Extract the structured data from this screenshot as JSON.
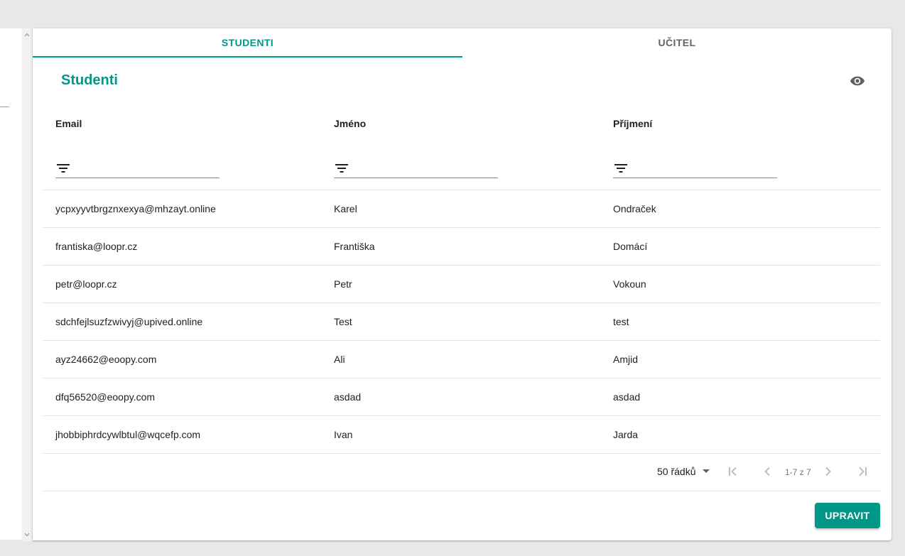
{
  "tabs": [
    {
      "label": "STUDENTI",
      "active": true
    },
    {
      "label": "UČITEL",
      "active": false
    }
  ],
  "section": {
    "title": "Studenti",
    "action_icon": "eye-icon"
  },
  "table": {
    "columns": [
      "Email",
      "Jméno",
      "Příjmení"
    ],
    "filter_icon": "filter-icon",
    "rows": [
      {
        "email": "ycpxyyvtbrgznxexya@mhzayt.online",
        "first_name": "Karel",
        "last_name": "Ondraček"
      },
      {
        "email": "frantiska@loopr.cz",
        "first_name": "Františka",
        "last_name": "Domácí"
      },
      {
        "email": "petr@loopr.cz",
        "first_name": "Petr",
        "last_name": "Vokoun"
      },
      {
        "email": "sdchfejlsuzfzwivyj@upived.online",
        "first_name": "Test",
        "last_name": "test"
      },
      {
        "email": "ayz24662@eoopy.com",
        "first_name": "Ali",
        "last_name": "Amjid"
      },
      {
        "email": "dfq56520@eoopy.com",
        "first_name": "asdad",
        "last_name": "asdad"
      },
      {
        "email": "jhobbiphrdcywlbtul@wqcefp.com",
        "first_name": "Ivan",
        "last_name": "Jarda"
      }
    ]
  },
  "pagination": {
    "rows_per_page": "50 řádků",
    "range": "1-7 z 7"
  },
  "actions": {
    "edit_label": "UPRAVIT"
  },
  "colors": {
    "accent": "#009688",
    "text": "#212121",
    "muted": "#757575",
    "divider": "#e0e0e0"
  }
}
